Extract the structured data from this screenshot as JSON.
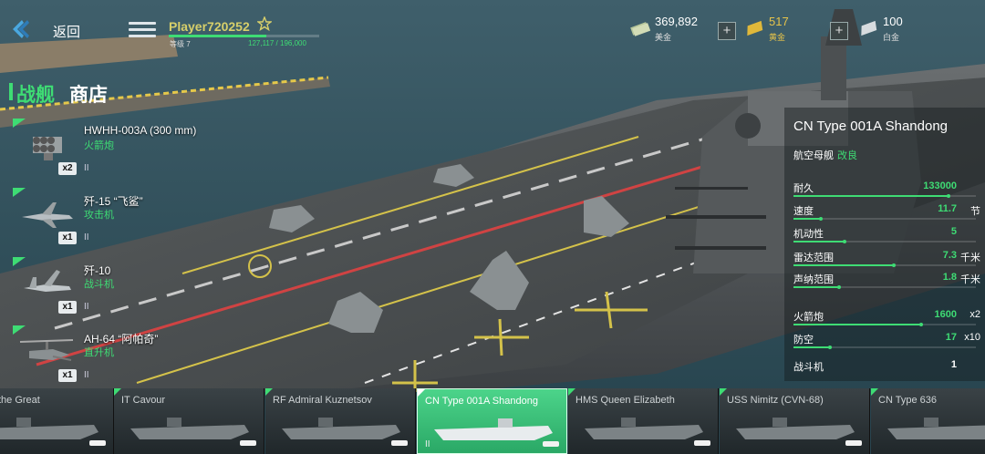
{
  "header": {
    "back_label": "返回",
    "player_name": "Player720252",
    "level_label": "等级 7",
    "xp_text": "127,117 / 196,000",
    "xp_progress": 0.65
  },
  "currencies": [
    {
      "value": "369,892",
      "name": "美金",
      "icon": "dollar-bills-icon"
    },
    {
      "value": "517",
      "name": "黄金",
      "icon": "gold-bar-icon"
    },
    {
      "value": "100",
      "name": "白金",
      "icon": "platinum-bar-icon"
    }
  ],
  "plus_label": "+",
  "store": {
    "title_green": "战舰",
    "title_white": "商店"
  },
  "weapons": [
    {
      "name": "HWHH-003A (300 mm)",
      "type": "火箭炮",
      "qty": "x2",
      "tier": "II",
      "icon": "rocket-launcher-icon"
    },
    {
      "name": "歼-15 “飞鲨”",
      "type": "攻击机",
      "qty": "x1",
      "tier": "II",
      "icon": "jet-fighter-icon"
    },
    {
      "name": "歼-10",
      "type": "战斗机",
      "qty": "x1",
      "tier": "II",
      "icon": "jet-fighter-icon"
    },
    {
      "name": "AH-64 “阿帕奇”",
      "type": "直升机",
      "qty": "x1",
      "tier": "II",
      "icon": "helicopter-icon"
    }
  ],
  "ship": {
    "name": "CN Type 001A Shandong",
    "class_label": "航空母舰",
    "modifier": "改良",
    "stats": [
      {
        "label": "耐久",
        "value": "133000",
        "unit": "",
        "level": 0.85
      },
      {
        "label": "速度",
        "value": "11.7",
        "unit": "节",
        "level": 0.15
      },
      {
        "label": "机动性",
        "value": "5",
        "unit": "",
        "level": 0.28
      },
      {
        "label": "雷达范围",
        "value": "7.3",
        "unit": "千米",
        "level": 0.55
      },
      {
        "label": "声纳范围",
        "value": "1.8",
        "unit": "千米",
        "level": 0.25
      },
      {
        "label": "火箭炮",
        "value": "1600",
        "unit": "x2",
        "level": 0.7
      },
      {
        "label": "防空",
        "value": "17",
        "unit": "x10",
        "level": 0.2
      },
      {
        "label": "战斗机",
        "value": "1",
        "unit": "",
        "level": null
      }
    ]
  },
  "carousel": [
    {
      "name": "ejong the Great",
      "tier": "",
      "active": false
    },
    {
      "name": "IT Cavour",
      "tier": "",
      "active": false
    },
    {
      "name": "RF Admiral Kuznetsov",
      "tier": "",
      "active": false
    },
    {
      "name": "CN Type 001A Shandong",
      "tier": "II",
      "active": true
    },
    {
      "name": "HMS Queen Elizabeth",
      "tier": "",
      "active": false
    },
    {
      "name": "USS Nimitz (CVN-68)",
      "tier": "",
      "active": false
    },
    {
      "name": "CN Type 636",
      "tier": "",
      "active": false
    }
  ],
  "colors": {
    "accent_green": "#3edc74",
    "player_gold": "#d7cf6a",
    "active_card": "#3fc47c"
  }
}
